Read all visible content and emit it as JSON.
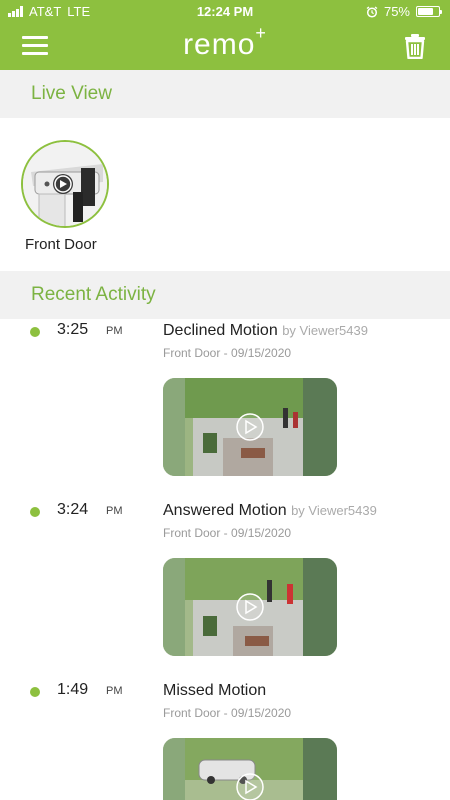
{
  "status_bar": {
    "carrier": "AT&T",
    "network": "LTE",
    "time": "12:24 PM",
    "battery_percent": "75%",
    "battery_level": 0.75
  },
  "nav": {
    "logo": "remo",
    "logo_sup": "+",
    "menu_icon": "hamburger-menu-icon",
    "trash_icon": "trash-icon"
  },
  "live_view": {
    "header": "Live View",
    "cameras": [
      {
        "name": "Front Door"
      }
    ]
  },
  "recent_activity": {
    "header": "Recent Activity",
    "items": [
      {
        "time": "3:25",
        "ampm": "PM",
        "title": "Declined Motion",
        "by": "by Viewer5439",
        "subtitle": "Front Door - 09/15/2020"
      },
      {
        "time": "3:24",
        "ampm": "PM",
        "title": "Answered Motion",
        "by": "by Viewer5439",
        "subtitle": "Front Door - 09/15/2020"
      },
      {
        "time": "1:49",
        "ampm": "PM",
        "title": "Missed Motion",
        "by": "",
        "subtitle": "Front Door - 09/15/2020"
      }
    ]
  },
  "colors": {
    "brand_green": "#8dc03f",
    "header_text_green": "#7cb342",
    "section_bg": "#f1f1f1"
  }
}
